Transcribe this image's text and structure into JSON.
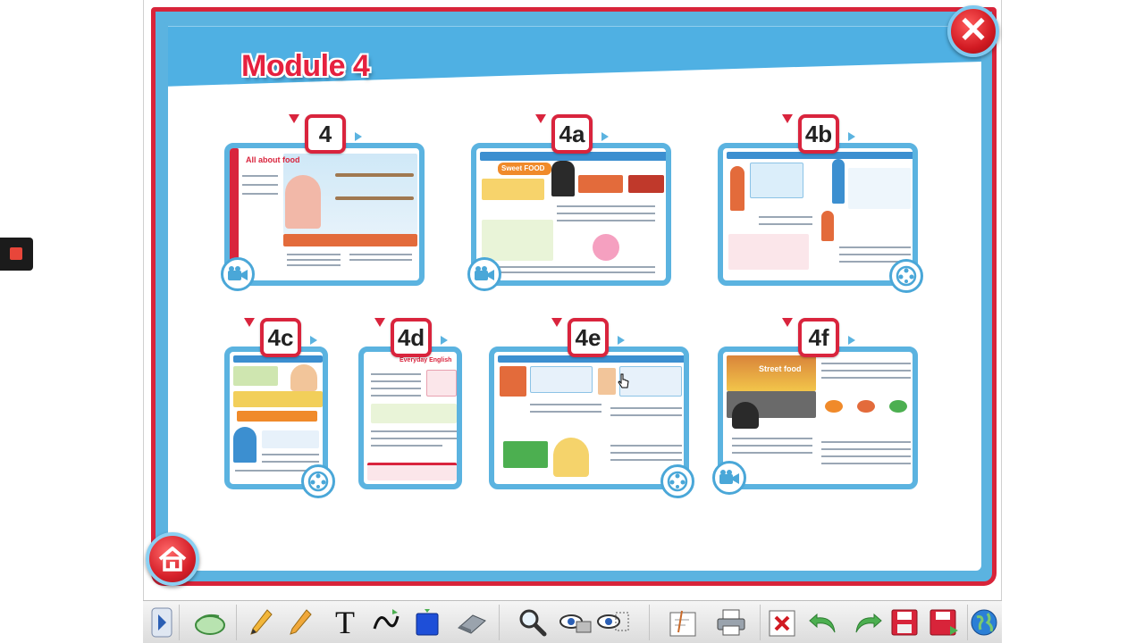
{
  "module": {
    "title": "Module 4"
  },
  "colors": {
    "frame_red": "#d8243a",
    "frame_blue": "#5bb3e0",
    "title_red": "#e6213f"
  },
  "buttons": {
    "close_icon": "close-icon",
    "home_icon": "home-icon"
  },
  "pages": [
    {
      "label": "4",
      "title": "All about food",
      "media": "video-camera-icon"
    },
    {
      "label": "4a",
      "title": "Sweet FOOD",
      "media": "video-camera-icon"
    },
    {
      "label": "4b",
      "title": "",
      "media": "film-reel-icon"
    },
    {
      "label": "4c",
      "title": "",
      "media": "film-reel-icon"
    },
    {
      "label": "4d",
      "title": "Everyday English",
      "media": ""
    },
    {
      "label": "4e",
      "title": "",
      "media": "film-reel-icon"
    },
    {
      "label": "4f",
      "title": "Street food",
      "media": "video-camera-icon"
    }
  ],
  "toolbar": {
    "tools": [
      "expand-arrow-icon",
      "mouse-pointer-icon",
      "pencil-icon",
      "highlighter-icon",
      "text-tool-icon",
      "curve-tool-icon",
      "shape-fill-icon",
      "eraser-icon",
      "zoom-icon",
      "reveal-icon",
      "spotlight-icon",
      "blank-page-icon",
      "print-icon",
      "clear-all-icon",
      "undo-icon",
      "redo-icon",
      "save-icon",
      "save-as-icon",
      "globe-icon"
    ],
    "text_tool_label": "T"
  }
}
